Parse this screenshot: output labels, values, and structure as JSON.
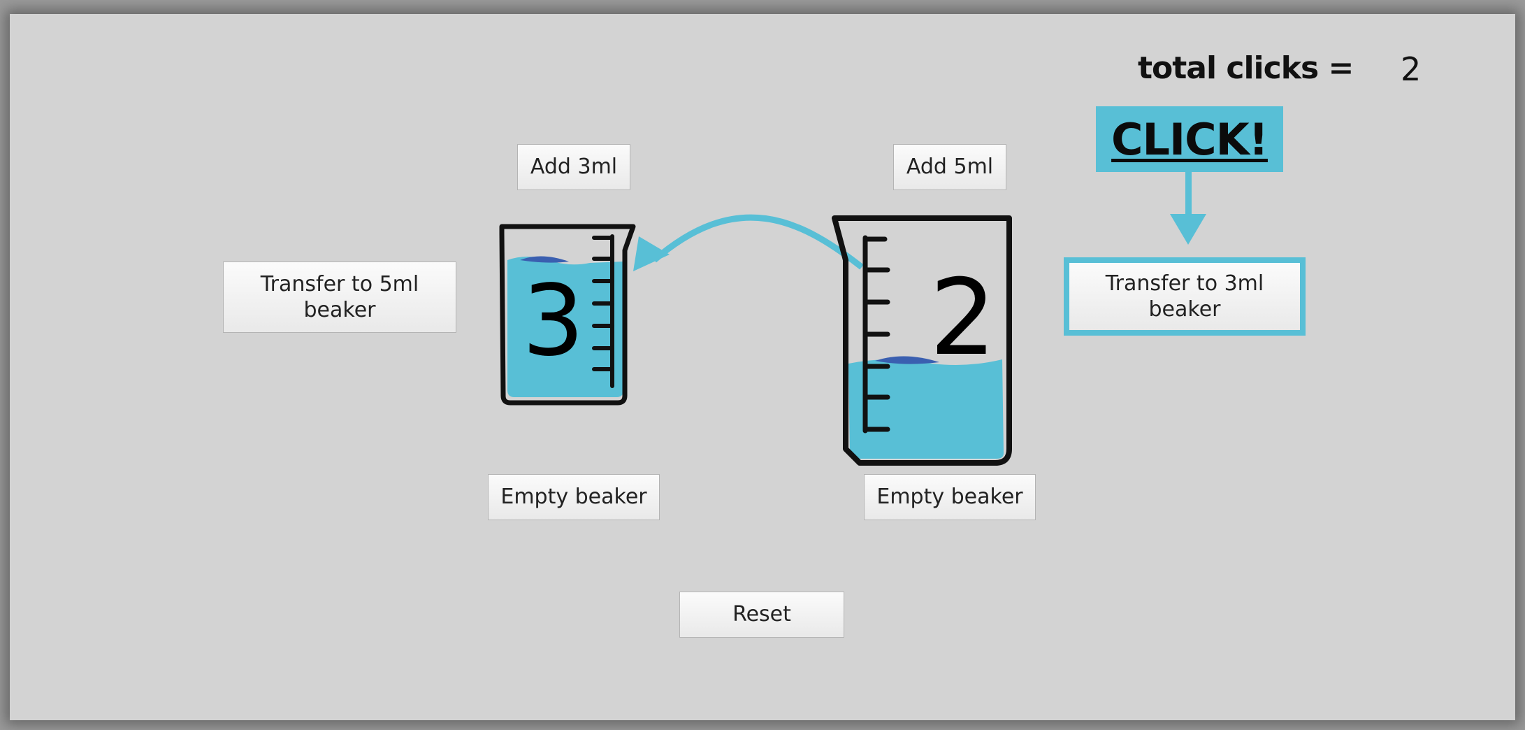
{
  "counter": {
    "label": "total clicks =",
    "value": "2"
  },
  "hint": {
    "text": "CLICK!"
  },
  "small_beaker": {
    "number": "3",
    "add_label": "Add 3ml",
    "transfer_label": "Transfer to 5ml beaker",
    "empty_label": "Empty beaker"
  },
  "large_beaker": {
    "number": "2",
    "add_label": "Add 5ml",
    "transfer_label": "Transfer to 3ml beaker",
    "empty_label": "Empty beaker"
  },
  "reset_label": "Reset",
  "colors": {
    "water": "#58bfd6",
    "water_dark": "#3a5fb0",
    "highlight": "#58bfd6"
  }
}
